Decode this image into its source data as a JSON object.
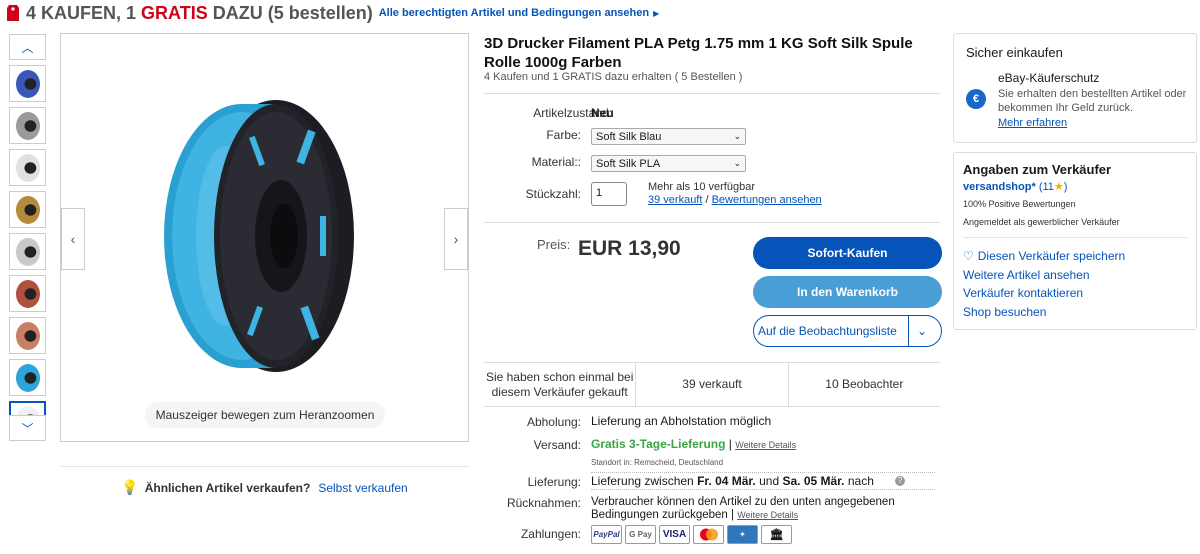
{
  "promo": {
    "part1": "4 KAUFEN, 1 ",
    "part2": "GRATIS",
    "part3": " DAZU (5 bestellen)",
    "link": "Alle berechtigten Artikel und Bedingungen ansehen",
    "icon": "price-tag-icon"
  },
  "gallery": {
    "zoom_hint": "Mauszeiger bewegen zum Heranzoomen",
    "thumb_colors": [
      "#3a56b8",
      "#9a9a9a",
      "#e0e0e0",
      "#b58a3a",
      "#c9c9c9",
      "#b0503f",
      "#c97f66",
      "#2fa4d8",
      "#f0f0f0"
    ],
    "active_thumb": 8
  },
  "sell_similar": {
    "question": "Ähnlichen Artikel verkaufen?",
    "link": "Selbst verkaufen"
  },
  "product": {
    "title": "3D Drucker Filament PLA Petg 1.75 mm 1 KG Soft Silk Spule Rolle 1000g Farben",
    "subtitle": "4 Kaufen und 1 GRATIS dazu erhalten ( 5 Bestellen )",
    "condition_label": "Artikelzustand:",
    "condition": "Neu",
    "color_label": "Farbe:",
    "color": "Soft Silk Blau",
    "material_label": "Material::",
    "material": "Soft Silk PLA",
    "qty_label": "Stückzahl:",
    "qty": "1",
    "available": "Mehr als 10 verfügbar",
    "sold_link": "39 verkauft",
    "slash": " / ",
    "reviews_link": "Bewertungen ansehen",
    "price_label": "Preis:",
    "price": "EUR 13,90",
    "buy_now": "Sofort-Kaufen",
    "add_cart": "In den Warenkorb",
    "watchlist": "Auf die Beobachtungsliste"
  },
  "stats": {
    "bought_before": "Sie haben schon einmal bei diesem Verkäufer gekauft",
    "sold": "39 verkauft",
    "watchers": "10 Beobachter"
  },
  "details": {
    "pickup_label": "Abholung:",
    "pickup": "Lieferung an Abholstation möglich",
    "shipping_label": "Versand:",
    "shipping": "Gratis 3-Tage-Lieferung",
    "shipping_sep": " | ",
    "shipping_link": "Weitere Details",
    "location": "Standort in:  Remscheid, Deutschland",
    "delivery_label": "Lieferung:",
    "delivery_pre": "Lieferung zwischen ",
    "delivery_from": "Fr. 04 Mär.",
    "delivery_and": " und ",
    "delivery_to": "Sa. 05 Mär.",
    "delivery_post": " nach",
    "returns_label": "Rücknahmen:",
    "returns": "Verbraucher können den Artikel zu den unten angegebenen Bedingungen zurückgeben",
    "returns_link": "Weitere Details",
    "payments_label": "Zahlungen:",
    "payments": [
      "PayPal",
      "G Pay",
      "VISA",
      "MC",
      "AMEX",
      "Bank"
    ]
  },
  "secure": {
    "title": "Sicher einkaufen",
    "protection_title": "eBay-Käuferschutz",
    "protection_text": "Sie erhalten den bestellten Artikel oder bekommen Ihr Geld zurück.",
    "learn_more": "Mehr erfahren",
    "icon": "shield-euro-icon"
  },
  "seller": {
    "title": "Angaben zum Verkäufer",
    "name": "versandshop*",
    "rating": "(11",
    "rating_end": ")",
    "positive": "100% Positive Bewertungen",
    "business": "Angemeldet als gewerblicher Verkäufer",
    "save": "Diesen Verkäufer speichern",
    "more_items": "Weitere Artikel ansehen",
    "contact": "Verkäufer kontaktieren",
    "visit_shop": "Shop besuchen"
  }
}
